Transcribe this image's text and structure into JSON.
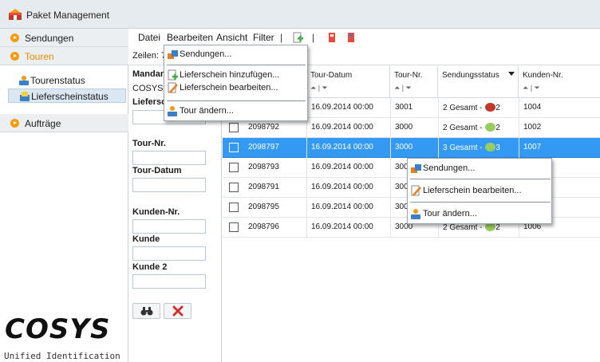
{
  "window": {
    "title": "Paket Management"
  },
  "nav": {
    "sections": [
      {
        "label": "Sendungen"
      },
      {
        "label": "Touren"
      },
      {
        "label": "Aufträge"
      }
    ],
    "touren_items": [
      {
        "label": "Tourenstatus"
      },
      {
        "label": "Lieferscheinstatus"
      }
    ]
  },
  "logo": {
    "text": "COSYS",
    "subtitle": "Unified Identification"
  },
  "menubar": [
    "Datei",
    "Bearbeiten",
    "Ansicht",
    "Filter"
  ],
  "toolbar": {
    "separator": "|"
  },
  "info": {
    "zeilen": "Zeilen: 7"
  },
  "filter": {
    "mandant_label": "Mandant",
    "mandant_value": "COSYS",
    "lieferschein_label": "Lieferschein",
    "tour_nr_label": "Tour-Nr.",
    "tour_datum_label": "Tour-Datum",
    "kunden_nr_label": "Kunden-Nr.",
    "kunde_label": "Kunde",
    "kunde2_label": "Kunde 2"
  },
  "grid": {
    "sort_indicator": "⏶ | ⏷",
    "columns": [
      "Tour-Datum",
      "Tour-Nr.",
      "Sendungsstatus",
      "Kunden-Nr."
    ],
    "rows": [
      {
        "lieferschein": "",
        "datum": "16.09.2014 00:00",
        "tour": "3001",
        "status": "2 Gesamt - ",
        "status_count": "2",
        "status_color": "#c0392b",
        "kunde": "1004"
      },
      {
        "lieferschein": "2098792",
        "datum": "16.09.2014 00:00",
        "tour": "3000",
        "status": "2 Gesamt - ",
        "status_count": "2",
        "status_color": "#9acd60",
        "kunde": "1002"
      },
      {
        "lieferschein": "2098797",
        "datum": "16.09.2014 00:00",
        "tour": "3000",
        "status": "3 Gesamt - ",
        "status_count": "3",
        "status_color": "#9acd60",
        "kunde": "1007"
      },
      {
        "lieferschein": "2098793",
        "datum": "16.09.2014 00:00",
        "tour": "300",
        "status": "",
        "status_count": "",
        "status_color": "",
        "kunde": ""
      },
      {
        "lieferschein": "2098791",
        "datum": "16.09.2014 00:00",
        "tour": "300",
        "status": "",
        "status_count": "",
        "status_color": "",
        "kunde": ""
      },
      {
        "lieferschein": "2098795",
        "datum": "16.09.2014 00:00",
        "tour": "300",
        "status": "",
        "status_count": "",
        "status_color": "",
        "kunde": ""
      },
      {
        "lieferschein": "2098796",
        "datum": "16.09.2014 00:00",
        "tour": "3000",
        "status": "2 Gesamt - ",
        "status_count": "2",
        "status_color": "#9acd60",
        "kunde": "1006"
      }
    ]
  },
  "dropdown_menu": {
    "items": [
      "Sendungen...",
      "Lieferschein hinzufügen...",
      "Lieferschein bearbeiten...",
      "Tour ändern..."
    ]
  },
  "context_menu": {
    "items": [
      "Sendungen...",
      "Lieferschein bearbeiten...",
      "Tour ändern..."
    ]
  },
  "colors": {
    "accent": "#f39c12",
    "selection": "#3399f3"
  }
}
